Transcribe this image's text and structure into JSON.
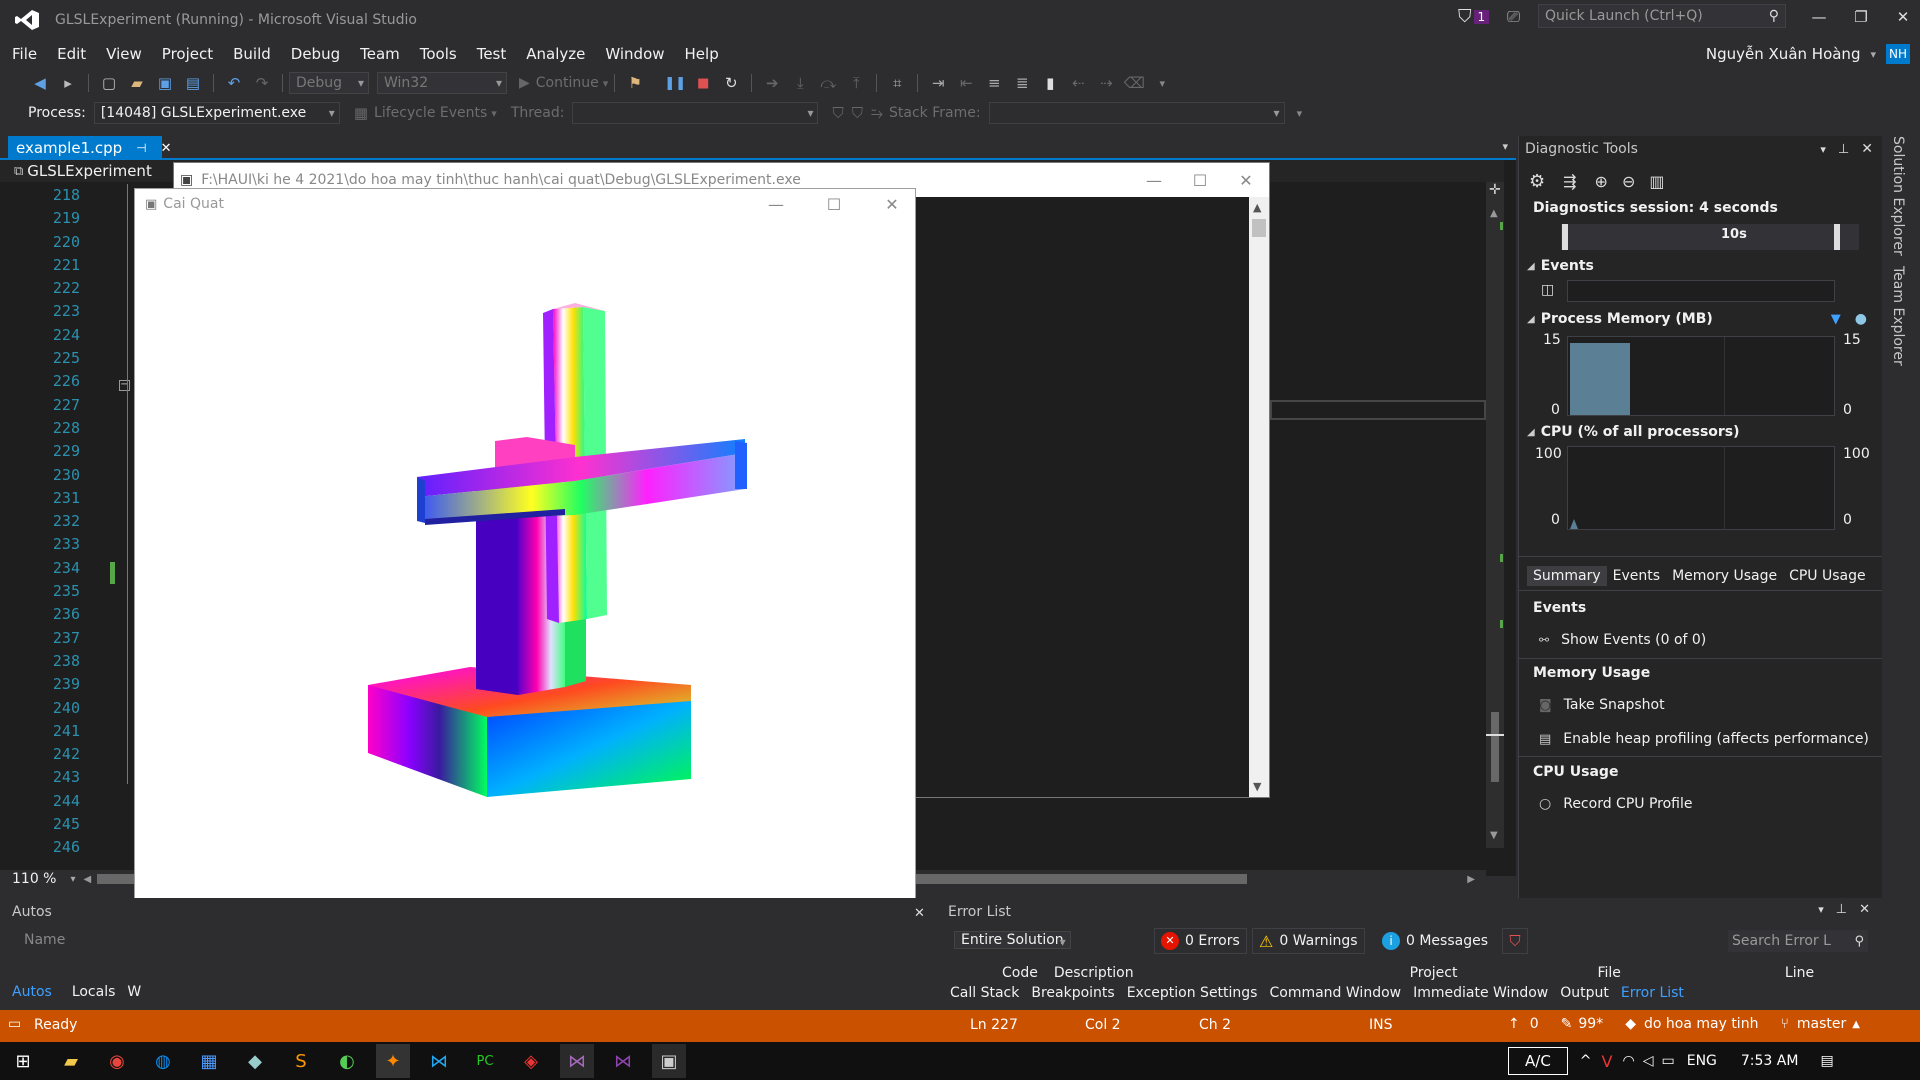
{
  "titlebar": {
    "title": "GLSLExperiment (Running) - Microsoft Visual Studio",
    "notif_count": "1",
    "quick_launch_placeholder": "Quick Launch (Ctrl+Q)",
    "user_name": "Nguyễn Xuân Hoàng",
    "avatar_initials": "NH"
  },
  "menu": [
    "File",
    "Edit",
    "View",
    "Project",
    "Build",
    "Debug",
    "Team",
    "Tools",
    "Test",
    "Analyze",
    "Window",
    "Help"
  ],
  "toolbar": {
    "config": "Debug",
    "platform": "Win32",
    "continue_label": "Continue"
  },
  "debugbar": {
    "process_label": "Process:",
    "process_value": "[14048] GLSLExperiment.exe",
    "lifecycle_label": "Lifecycle Events",
    "thread_label": "Thread:",
    "stackframe_label": "Stack Frame:"
  },
  "doc": {
    "tab_name": "example1.cpp",
    "tab_pin": "⊣",
    "project": "GLSLExperiment"
  },
  "line_numbers": [
    "218",
    "219",
    "220",
    "221",
    "222",
    "223",
    "224",
    "225",
    "226",
    "227",
    "228",
    "229",
    "230",
    "231",
    "232",
    "233",
    "234",
    "235",
    "236",
    "237",
    "238",
    "239",
    "240",
    "241",
    "242",
    "243",
    "244",
    "245",
    "246"
  ],
  "editor": {
    "zoom": "110 %"
  },
  "console_window": {
    "title": "F:\\HAUI\\ki he 4 2021\\do hoa may tinh\\thuc hanh\\cai quat\\Debug\\GLSLExperiment.exe"
  },
  "gl_window": {
    "title": "Cai Quat"
  },
  "diagnostics": {
    "title": "Diagnostic Tools",
    "session": "Diagnostics session: 4 seconds",
    "timeline_tick": "10s",
    "events_header": "Events",
    "memory_header": "Process Memory (MB)",
    "memory_max": "15",
    "memory_min": "0",
    "cpu_header": "CPU (% of all processors)",
    "cpu_max": "100",
    "cpu_min": "0",
    "tabs": [
      "Summary",
      "Events",
      "Memory Usage",
      "CPU Usage"
    ],
    "summary": {
      "events_title": "Events",
      "show_events": "Show Events (0 of 0)",
      "memory_title": "Memory Usage",
      "take_snapshot": "Take Snapshot",
      "heap_profiling": "Enable heap profiling (affects performance)",
      "cpu_title": "CPU Usage",
      "record_cpu": "Record CPU Profile"
    }
  },
  "side_tabs": [
    "Solution Explorer",
    "Team Explorer"
  ],
  "autos": {
    "title": "Autos",
    "col_name": "Name",
    "tabs": [
      "Autos",
      "Locals",
      "W"
    ]
  },
  "errorlist": {
    "title": "Error List",
    "scope": "Entire Solution",
    "errors": "0 Errors",
    "warnings": "0 Warnings",
    "messages": "0 Messages",
    "search_placeholder": "Search Error L",
    "columns": [
      "Code",
      "Description",
      "Project",
      "File",
      "Line"
    ],
    "tabs": [
      "Call Stack",
      "Breakpoints",
      "Exception Settings",
      "Command Window",
      "Immediate Window",
      "Output",
      "Error List"
    ]
  },
  "status": {
    "ready": "Ready",
    "ln": "Ln 227",
    "col": "Col 2",
    "ch": "Ch 2",
    "ins": "INS",
    "arrows": "0",
    "edits": "99*",
    "repo": "do hoa may tinh",
    "branch": "master"
  },
  "taskbar": {
    "ime": "A/C",
    "lang": "ENG",
    "time": "7:53 AM"
  },
  "colors": {
    "accent": "#007acc",
    "status_bg": "#ca5100",
    "vs_purple": "#68217a"
  }
}
